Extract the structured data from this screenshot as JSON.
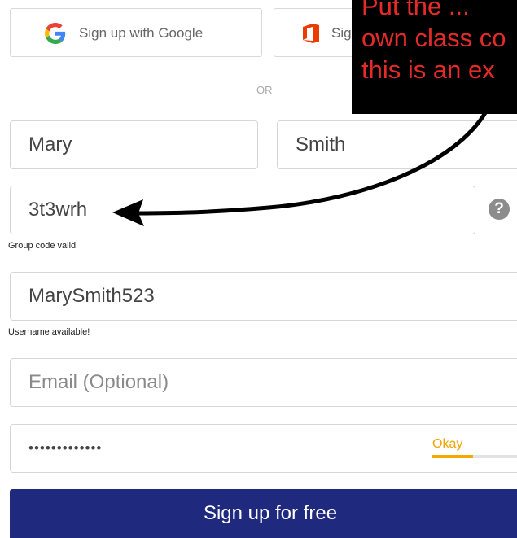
{
  "sso": {
    "google_label": "Sign up with Google",
    "office_label": "Sig"
  },
  "divider_text": "OR",
  "form": {
    "first_name": "Mary",
    "last_name": "Smith",
    "group_code": "3t3wrh",
    "group_code_status": "Group code valid",
    "group_code_help": "?",
    "username": "MarySmith523",
    "username_status": "Username available!",
    "email_placeholder": "Email (Optional)",
    "password_masked": "•••••••••••••",
    "password_strength_label": "Okay",
    "password_strength_fraction": 0.45
  },
  "submit_label": "Sign up for free",
  "callout": {
    "lines": [
      "Put the ...",
      "own class co",
      "this is an ex"
    ]
  },
  "colors": {
    "primary_button": "#1f2a7e",
    "callout_background": "#000000",
    "callout_text": "#e52a2a",
    "strength_okay": "#f5a900",
    "google_blue": "#4285F4",
    "office_orange": "#EB3C00"
  },
  "icons": {
    "google": "google-g-logo",
    "office": "office-logo",
    "help": "question-circle",
    "annotation_arrow": "curved-arrow"
  }
}
